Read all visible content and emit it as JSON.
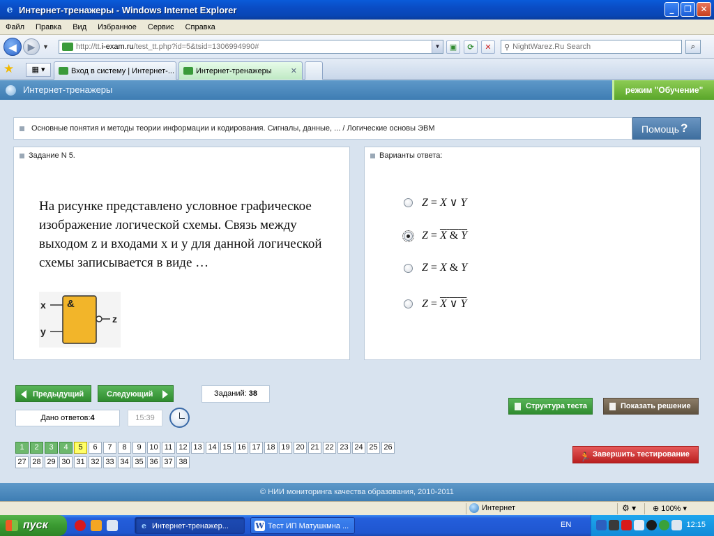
{
  "window": {
    "title": "Интернет-тренажеры - Windows Internet Explorer",
    "btn_min": "_",
    "btn_max": "❐",
    "btn_close": "✕"
  },
  "menu": [
    "Файл",
    "Правка",
    "Вид",
    "Избранное",
    "Сервис",
    "Справка"
  ],
  "address": {
    "url_prefix": "http://tt.",
    "url_domain": "i-exam.ru",
    "url_rest": "/test_tt.php?id=5&tsid=1306994990#",
    "search_placeholder": "NightWarez.Ru Search"
  },
  "tabs": [
    {
      "label": "Вход в систему | Интернет-..."
    },
    {
      "label": "Интернет-тренажеры",
      "close": "✕"
    }
  ],
  "app": {
    "title": "Интернет-тренажеры",
    "mode": "режим \"Обучение\"",
    "topic": "Основные понятия и методы теории информации и кодирования. Сигналы, данные, ... / Логические основы ЭВМ",
    "help_label": "Помощь",
    "help_icon": "?"
  },
  "task": {
    "header": "Задание N 5.",
    "question": "На рисунке представлено условное графическое изображение логической схемы. Связь между выходом z и входами x и y для данной логической схемы записывается в виде …",
    "gate": {
      "input_x": "x",
      "input_y": "y",
      "output": "z",
      "symbol": "&",
      "fill_color": "#f2b52a",
      "stroke_color": "#333333"
    }
  },
  "answers": {
    "header": "Варианты ответа:",
    "selected_index": 1,
    "options": [
      {
        "lhs": "Z",
        "eq": "=",
        "a": "X",
        "op": "∨",
        "b": "Y",
        "negated": false
      },
      {
        "lhs": "Z",
        "eq": "=",
        "a": "X",
        "op": "&",
        "b": "Y",
        "negated": true
      },
      {
        "lhs": "Z",
        "eq": "=",
        "a": "X",
        "op": "&",
        "b": "Y",
        "negated": false
      },
      {
        "lhs": "Z",
        "eq": "=",
        "a": "X",
        "op": "∨",
        "b": "Y",
        "negated": true
      }
    ]
  },
  "nav": {
    "prev_label": "Предыдущий",
    "next_label": "Следующий",
    "tasks_label": "Заданий:",
    "tasks_total": "38",
    "answered_label": "Дано ответов:",
    "answered_count": "4",
    "timer": "15:39",
    "structure_label": "Структура теста",
    "solution_label": "Показать решение",
    "finish_label": "Завершить тестирование"
  },
  "numbers": {
    "total": 38,
    "per_row": 26,
    "done": [
      1,
      2,
      3,
      4
    ],
    "current": 5
  },
  "footer": "© НИИ мониторинга качества образования, 2010-2011",
  "statusbar": {
    "zone": "Интернет",
    "zoom": "100%"
  },
  "taskbar": {
    "start": "пуск",
    "items": [
      "Интернет-тренажер...",
      "Тест ИП Матушкмна ..."
    ],
    "lang": "EN",
    "time": "12:15"
  },
  "colors": {
    "accent_blue": "#3e7db3",
    "done_green": "#6db86d",
    "current_yellow": "#ffff66",
    "finish_red": "#b91f1f"
  }
}
